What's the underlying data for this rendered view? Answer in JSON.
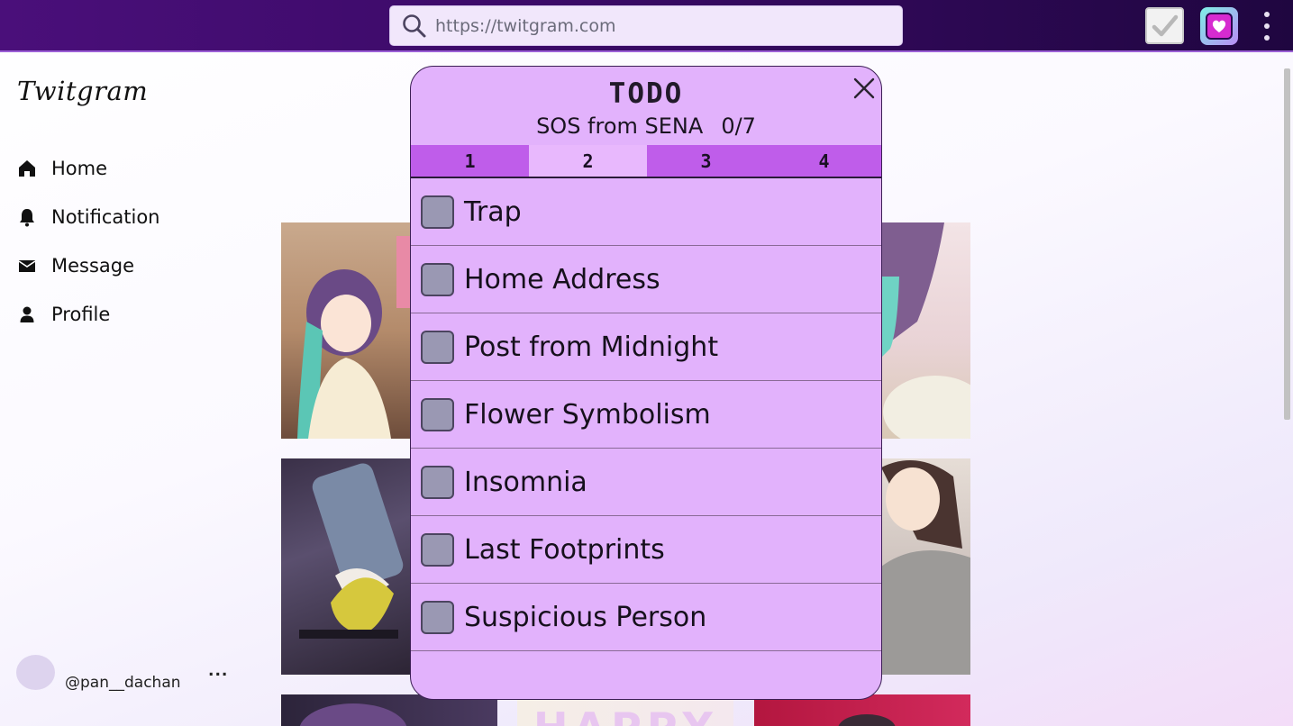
{
  "browser": {
    "url": "https://twitgram.com",
    "icons": [
      "search-icon",
      "check-icon",
      "heart-app-icon",
      "kebab-menu-icon"
    ]
  },
  "sidebar": {
    "logo": "Twitgram",
    "items": [
      {
        "label": "Home",
        "icon": "home-icon"
      },
      {
        "label": "Notification",
        "icon": "bell-icon"
      },
      {
        "label": "Message",
        "icon": "envelope-icon"
      },
      {
        "label": "Profile",
        "icon": "person-icon"
      }
    ],
    "user": {
      "handle": "@pan__dachan",
      "more": "..."
    }
  },
  "feed": {
    "banner_text": "HAPPY"
  },
  "todo_modal": {
    "title": "TODO",
    "subtitle": "SOS from SENA",
    "progress": "0/7",
    "tabs": [
      "1",
      "2",
      "3",
      "4"
    ],
    "active_tab": "2",
    "items": [
      {
        "label": "Trap",
        "checked": false
      },
      {
        "label": "Home Address",
        "checked": false
      },
      {
        "label": "Post from Midnight",
        "checked": false
      },
      {
        "label": "Flower Symbolism",
        "checked": false
      },
      {
        "label": "Insomnia",
        "checked": false
      },
      {
        "label": "Last Footprints",
        "checked": false
      },
      {
        "label": "Suspicious Person",
        "checked": false
      }
    ]
  },
  "colors": {
    "topbar": "#3a0a66",
    "modal_bg": "#e2b2fc",
    "tab_bg": "#bf5dea",
    "tab_active": "#e8b8fd",
    "checkbox": "#9a98b3"
  }
}
